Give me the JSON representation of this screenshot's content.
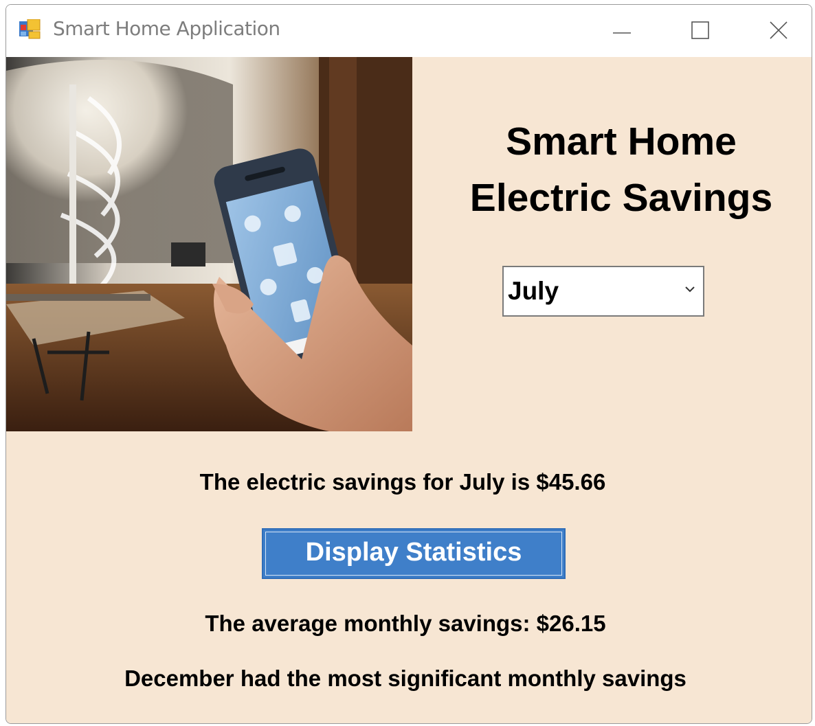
{
  "window": {
    "title": "Smart Home Application"
  },
  "heading": {
    "line1": "Smart Home",
    "line2": "Electric Savings"
  },
  "month_select": {
    "selected": "July"
  },
  "results": {
    "monthly_savings_text": "The electric savings for July is $45.66",
    "average_text": "The average monthly savings: $26.15",
    "max_text": "December had the most significant monthly savings"
  },
  "buttons": {
    "display_statistics": "Display Statistics"
  },
  "icons": {
    "app": "app-window-icon",
    "minimize": "minimize-icon",
    "maximize": "maximize-icon",
    "close": "close-icon",
    "dropdown": "chevron-down-icon"
  },
  "colors": {
    "client_background": "#f7e6d3",
    "button_background": "#3f7fc9",
    "button_text": "#ffffff"
  }
}
